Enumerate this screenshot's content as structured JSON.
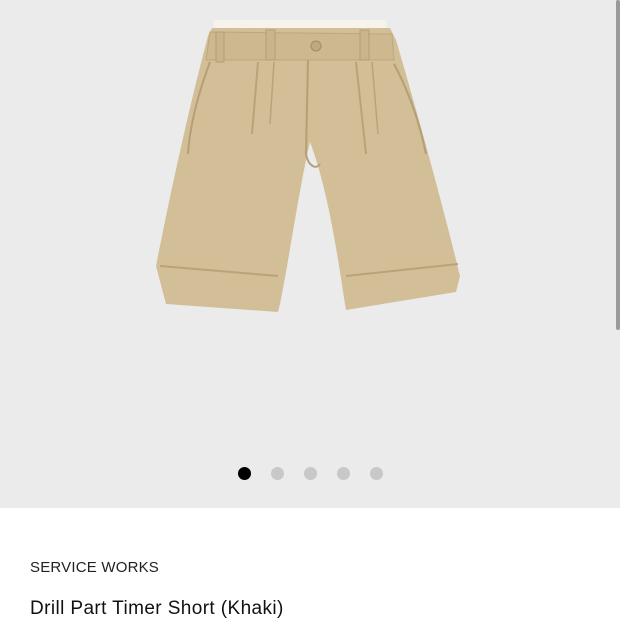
{
  "gallery": {
    "image": "khaki-pleated-shorts-photo",
    "background_color": "#ebebeb",
    "dots_total": 5,
    "active_dot": 1
  },
  "product": {
    "brand": "SERVICE WORKS",
    "title": "Drill Part Timer Short (Khaki)",
    "color_hex": "#d4c19a"
  }
}
